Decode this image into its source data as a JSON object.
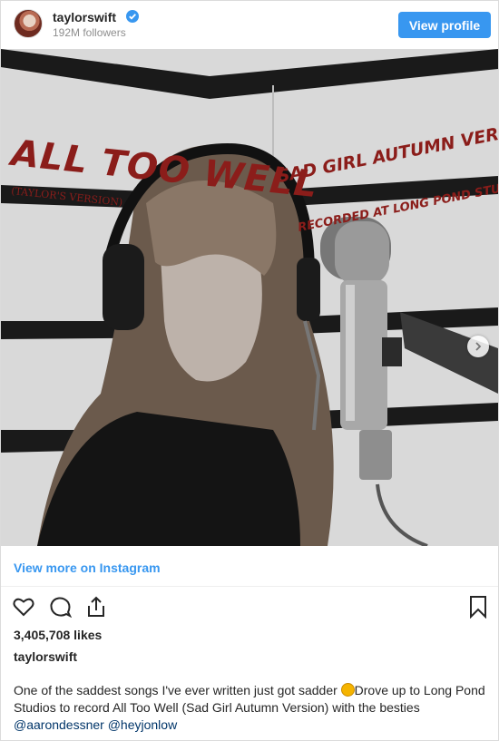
{
  "header": {
    "username": "taylorswift",
    "followers": "192M followers",
    "view_profile_label": "View profile"
  },
  "photo": {
    "title": "ALL TOO WELL",
    "title_sub": "(TAYLOR'S VERSION)",
    "version": "SAD GIRL AUTUMN VERSION",
    "location": "RECORDED AT LONG POND STUDIOS",
    "carousel_position": 1,
    "carousel_count": 2
  },
  "links": {
    "view_more": "View more on Instagram"
  },
  "actions": {
    "icons": [
      "heart-icon",
      "comment-icon",
      "share-icon",
      "bookmark-icon"
    ]
  },
  "post": {
    "likes": "3,405,708 likes",
    "caption_user": "taylorswift",
    "caption_part1": "One of the saddest songs I've ever written just got sadder",
    "caption_part2": "Drove up to Long Pond Studios to record All Too Well (Sad Girl Autumn Version) with the besties",
    "mention1": "@aarondessner",
    "mention2": "@heyjonlow"
  },
  "colors": {
    "accent": "#3897f0",
    "title_red": "#8b1d1a"
  }
}
